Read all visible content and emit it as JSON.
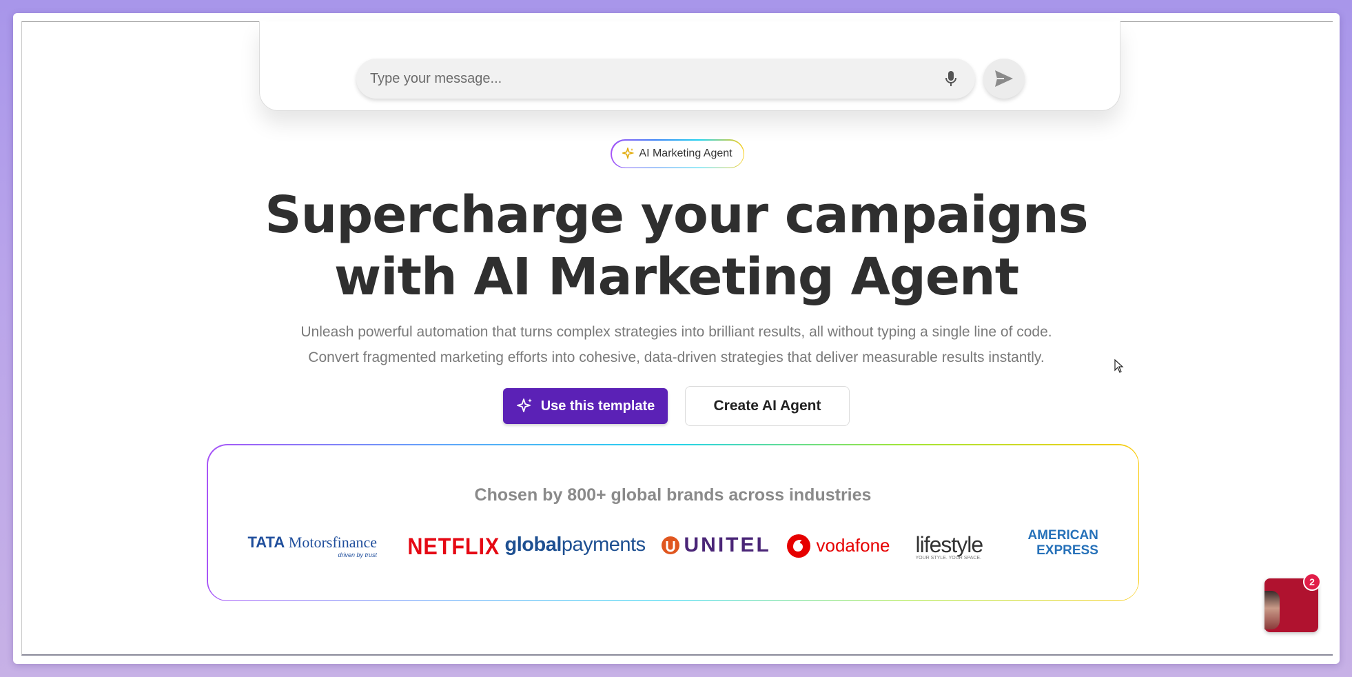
{
  "chat": {
    "placeholder": "Type your message...",
    "mic_icon": "microphone-icon",
    "send_icon": "send-icon"
  },
  "badge": {
    "label": "AI Marketing Agent",
    "icon": "sparkles-icon"
  },
  "hero": {
    "headline_line1": "Supercharge your campaigns",
    "headline_line2": "with AI Marketing Agent",
    "sub_line1": "Unleash powerful automation that turns complex strategies into brilliant results, all without typing a single line of code.",
    "sub_line2": "Convert fragmented marketing efforts into cohesive, data-driven strategies that deliver measurable results instantly."
  },
  "buttons": {
    "primary": "Use this template",
    "secondary": "Create AI Agent"
  },
  "brands": {
    "title": "Chosen by 800+ global brands across industries",
    "logos": [
      {
        "name": "TATA Motorsfinance",
        "tagline": "driven by trust",
        "color": "#1f4e9c"
      },
      {
        "name": "NETFLIX",
        "color": "#e50914"
      },
      {
        "name": "globalpayments",
        "color": "#1d4f91"
      },
      {
        "name": "UNITEL",
        "color": "#4a2577"
      },
      {
        "name": "vodafone",
        "color": "#e60000"
      },
      {
        "name": "lifestyle",
        "tagline": "YOUR STYLE. YOUR SPACE.",
        "color": "#333333"
      },
      {
        "name": "AMERICAN EXPRESS",
        "color": "#2671b9"
      }
    ]
  },
  "widget": {
    "notification_count": "2"
  },
  "colors": {
    "primary": "#5b21b6",
    "heading": "#2f2f2f",
    "muted": "#7a7a7a"
  }
}
